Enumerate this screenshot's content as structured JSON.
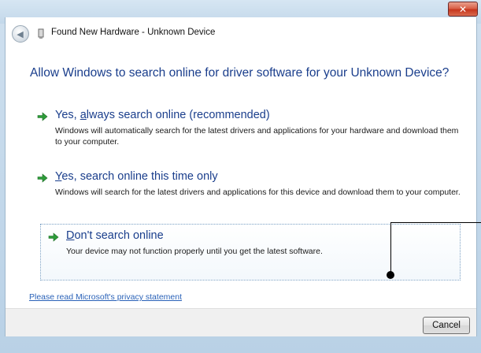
{
  "window": {
    "title": "Found New Hardware - Unknown Device",
    "close_label": "✕"
  },
  "heading": "Allow Windows to search online for driver software for your Unknown Device?",
  "options": [
    {
      "title_pre": "Yes, ",
      "title_key": "a",
      "title_post": "lways search online (recommended)",
      "desc": "Windows will automatically search for the latest drivers and applications for your hardware and download them to your computer."
    },
    {
      "title_pre": "",
      "title_key": "Y",
      "title_post": "es, search online this time only",
      "desc": "Windows will search for the latest drivers and applications for this device and download them to your computer."
    },
    {
      "title_pre": "",
      "title_key": "D",
      "title_post": "on't search online",
      "desc": "Your device may not function properly until you get the latest software."
    }
  ],
  "privacy_link": "Please read Microsoft's privacy statement",
  "footer": {
    "cancel_label": "Cancel"
  },
  "colors": {
    "heading": "#1a3e8c",
    "arrow": "#2e9c3a",
    "link": "#2a62b8"
  }
}
